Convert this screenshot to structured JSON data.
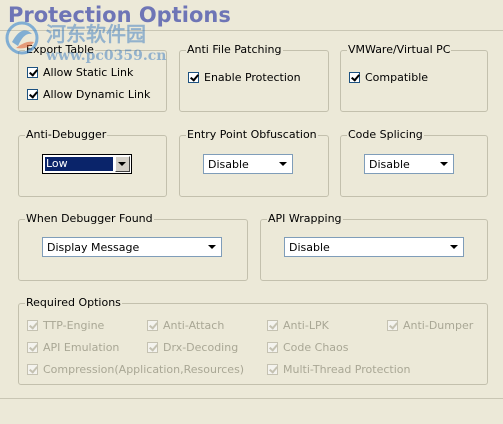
{
  "window": {
    "title": "Protection Options"
  },
  "watermark": {
    "site_name": "河东软件园",
    "url": "www.pc0359.cn"
  },
  "export_table": {
    "legend": "Export Table",
    "allow_static": {
      "label": "Allow Static Link",
      "checked": true
    },
    "allow_dynamic": {
      "label": "Allow Dynamic Link",
      "checked": true
    }
  },
  "anti_file_patching": {
    "legend": "Anti File Patching",
    "enable_protection": {
      "label": "Enable Protection",
      "checked": true
    }
  },
  "vmware": {
    "legend": "VMWare/Virtual PC",
    "compatible": {
      "label": "Compatible",
      "checked": true
    }
  },
  "anti_debugger": {
    "legend": "Anti-Debugger",
    "value": "Low"
  },
  "entry_point": {
    "legend": "Entry Point Obfuscation",
    "value": "Disable"
  },
  "code_splicing": {
    "legend": "Code Splicing",
    "value": "Disable"
  },
  "debugger_found": {
    "legend": "When Debugger Found",
    "value": "Display Message"
  },
  "api_wrapping": {
    "legend": "API Wrapping",
    "value": "Disable"
  },
  "required": {
    "legend": "Required Options",
    "items": [
      {
        "label": "TTP-Engine",
        "checked": true
      },
      {
        "label": "Anti-Attach",
        "checked": true
      },
      {
        "label": "Anti-LPK",
        "checked": true
      },
      {
        "label": "Anti-Dumper",
        "checked": true
      },
      {
        "label": "API Emulation",
        "checked": true
      },
      {
        "label": "Drx-Decoding",
        "checked": true
      },
      {
        "label": "Code Chaos",
        "checked": true
      },
      {
        "label": "Compression(Application,Resources)",
        "checked": true
      },
      {
        "label": "Multi-Thread Protection",
        "checked": true
      }
    ]
  },
  "colors": {
    "title": "#6e75b6",
    "background": "#ece9d8",
    "check": "#21a121",
    "selection": "#0a246a"
  }
}
